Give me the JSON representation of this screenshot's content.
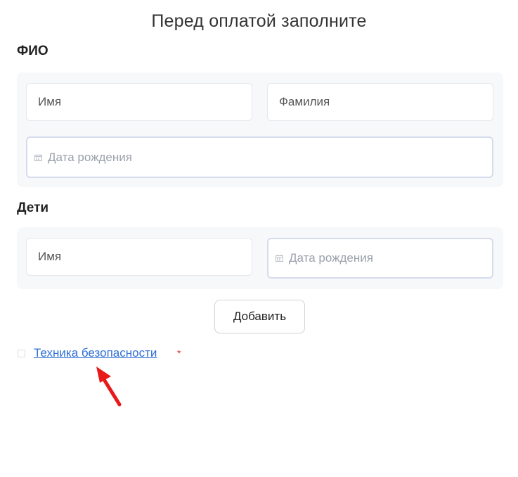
{
  "page": {
    "title": "Перед оплатой заполните"
  },
  "fio_section": {
    "title": "ФИО",
    "first_name_placeholder": "Имя",
    "last_name_placeholder": "Фамилия",
    "birth_date_placeholder": "Дата рождения"
  },
  "children_section": {
    "title": "Дети",
    "name_placeholder": "Имя",
    "birth_date_placeholder": "Дата рождения"
  },
  "actions": {
    "add_label": "Добавить"
  },
  "agreement": {
    "link_text": "Техника безопасности",
    "required_mark": "*",
    "checked": false
  },
  "colors": {
    "link": "#2f6fd6",
    "required": "#e03b3b",
    "annotation_arrow": "#e8191b",
    "panel_bg": "#f7f8fa"
  },
  "icons": {
    "date_field_icon": "calendar-icon",
    "annotation": "red-arrow-icon"
  }
}
